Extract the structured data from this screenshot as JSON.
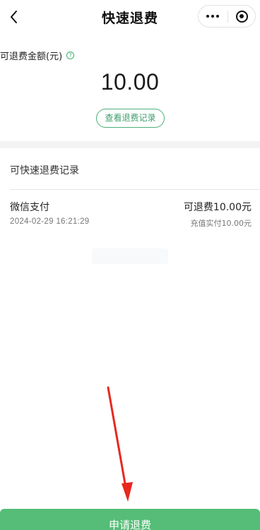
{
  "header": {
    "title": "快速退费"
  },
  "amount": {
    "label": "可退费金额(元)",
    "value": "10.00",
    "record_button_label": "查看退费记录"
  },
  "records": {
    "section_title": "可快速退费记录",
    "items": [
      {
        "method": "微信支付",
        "time": "2024-02-29 16:21:29",
        "refundable": "可退费10.00元",
        "paid": "充值实付10.00元"
      }
    ]
  },
  "footer": {
    "apply_button_label": "申请退费"
  },
  "colors": {
    "accent": "#55bd77",
    "accent_text": "#3d9e6a",
    "annotation_arrow": "#e8281f"
  },
  "icons": {
    "back": "chevron-left-icon",
    "more": "more-dots-icon",
    "close": "target-close-icon",
    "help": "question-circle-icon",
    "annotation": "red-arrow-icon"
  }
}
